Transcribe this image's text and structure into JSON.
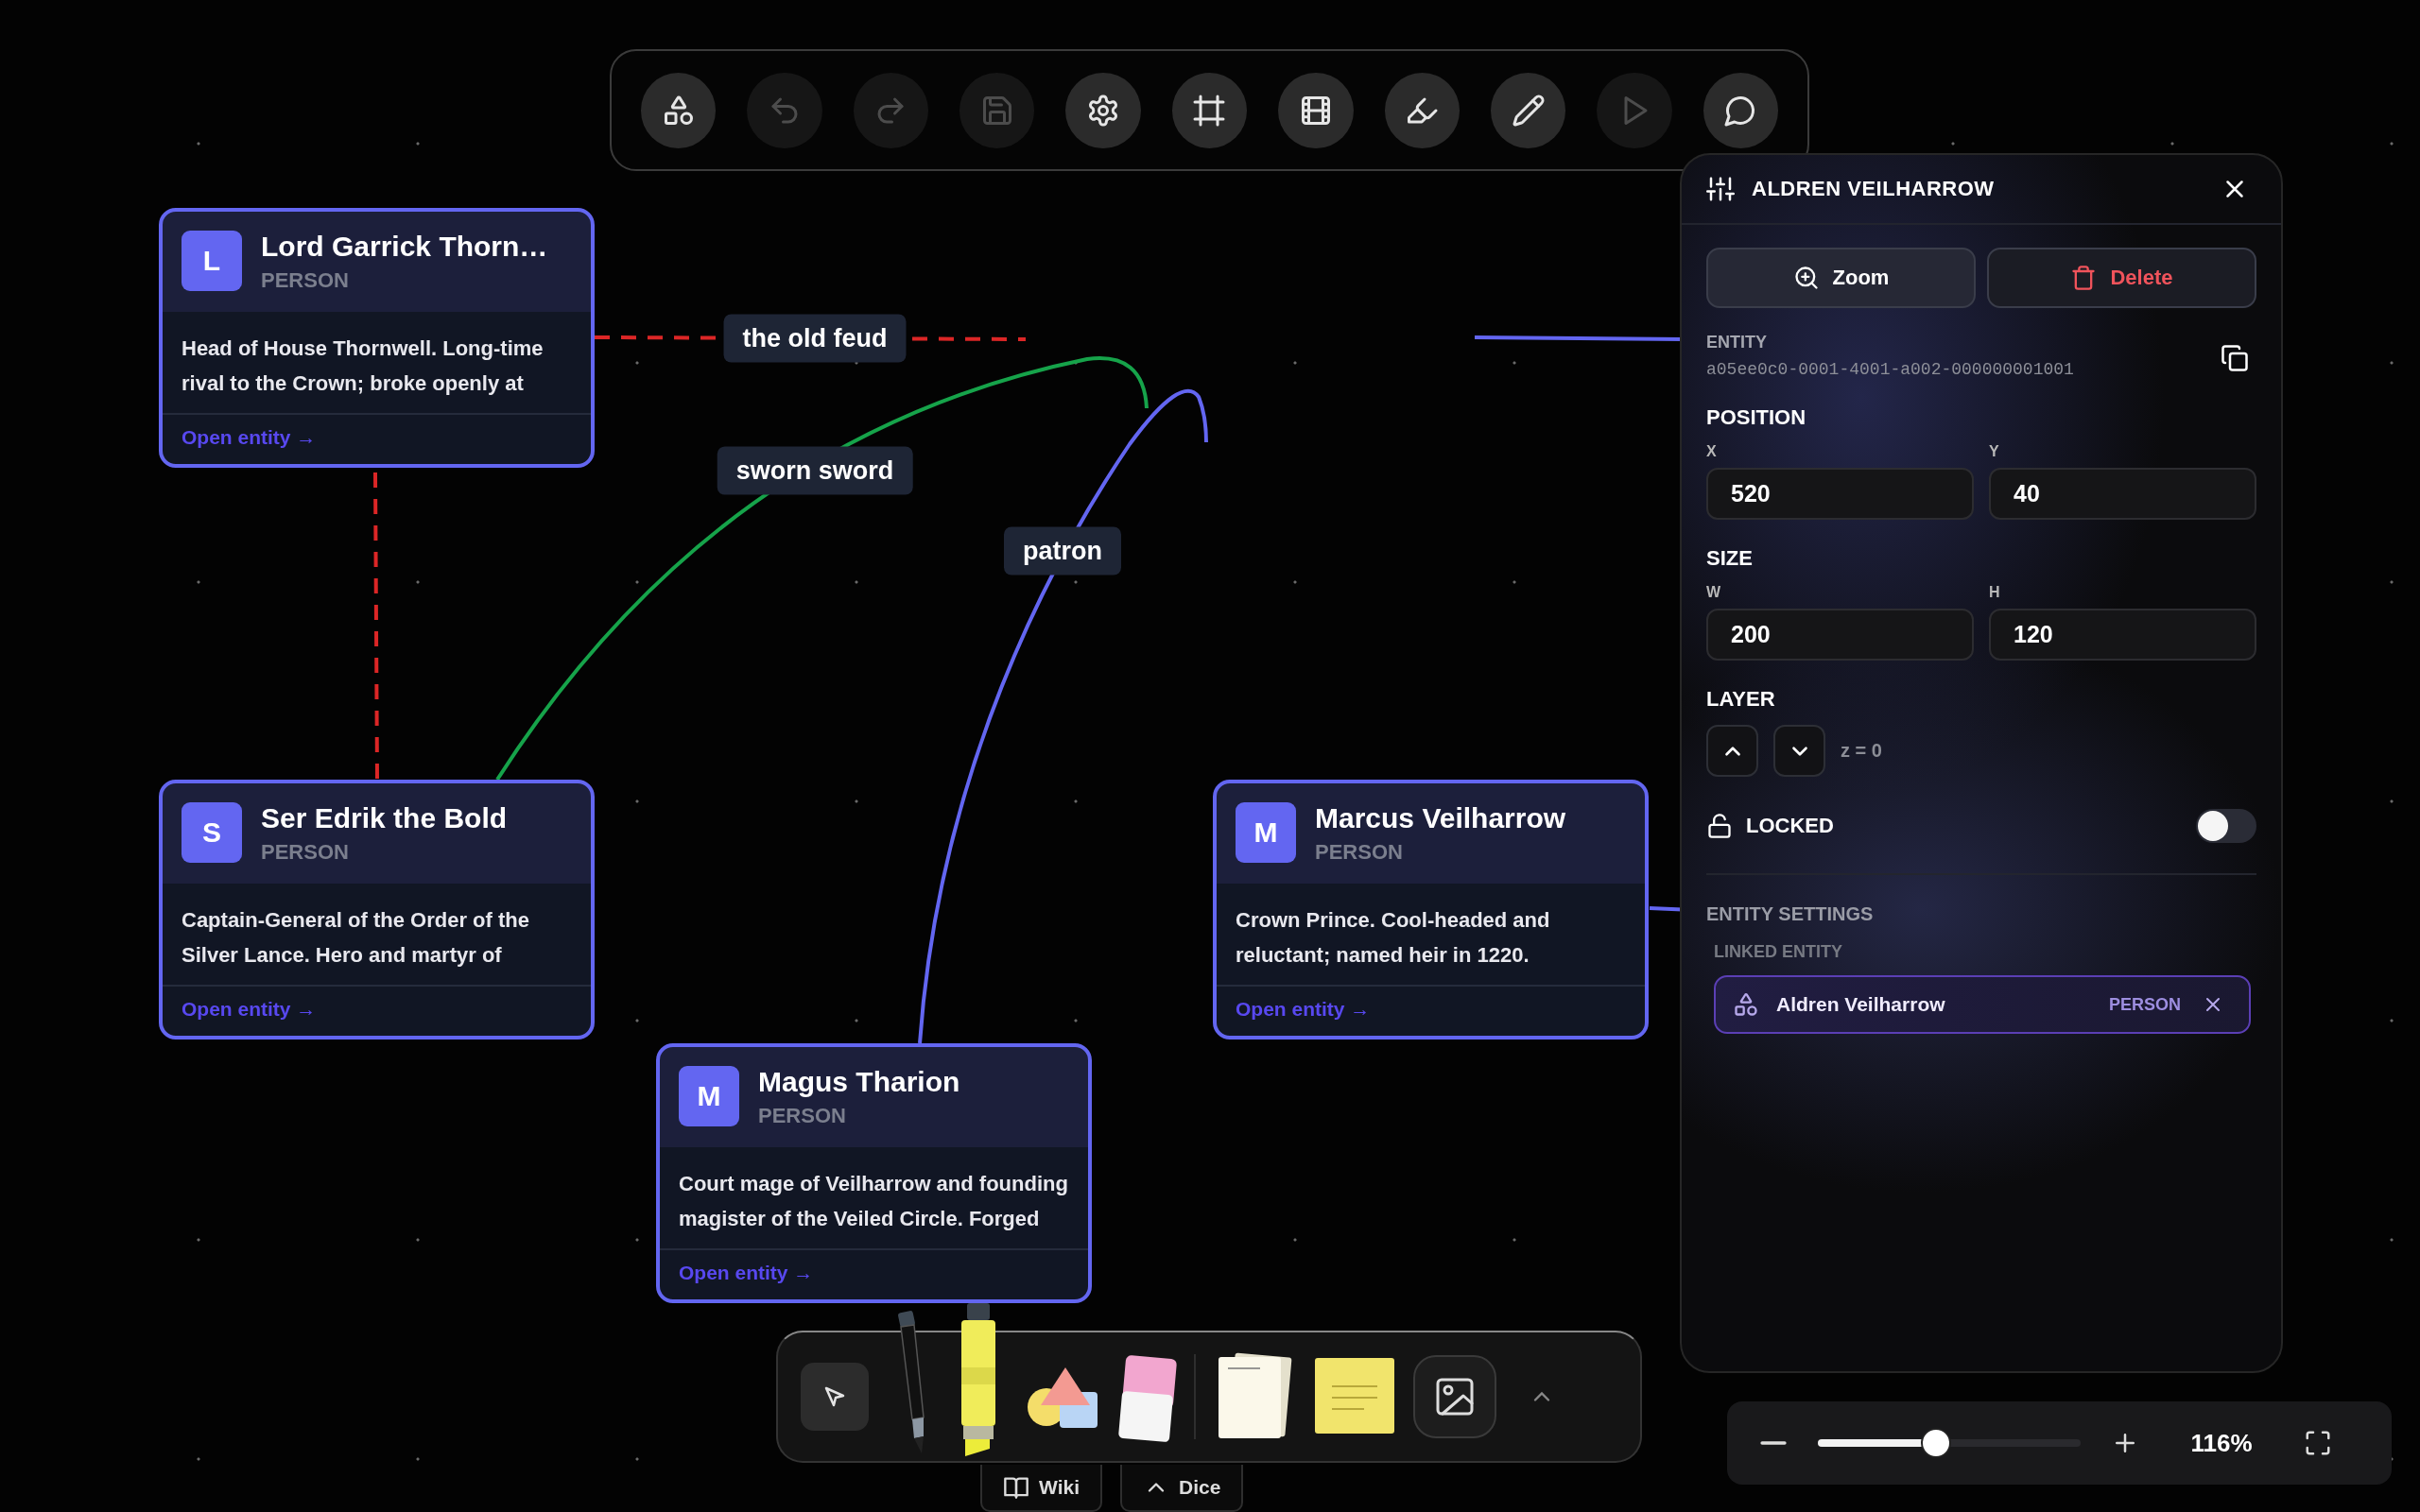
{
  "toolbar": [
    {
      "kind": "shapes",
      "disabled": false
    },
    {
      "kind": "undo",
      "disabled": true
    },
    {
      "kind": "redo",
      "disabled": true
    },
    {
      "kind": "save",
      "disabled": true
    },
    {
      "kind": "settings",
      "disabled": false
    },
    {
      "kind": "frame",
      "disabled": false
    },
    {
      "kind": "film",
      "disabled": false
    },
    {
      "kind": "highlighter",
      "disabled": false
    },
    {
      "kind": "pencil",
      "disabled": false
    },
    {
      "kind": "play",
      "disabled": true
    },
    {
      "kind": "comment",
      "disabled": false
    }
  ],
  "canvas": {
    "nodes": [
      {
        "initial": "L",
        "name": "Lord Garrick Thorn…",
        "type": "PERSON",
        "description": "Head of House Thornwell. Long-time rival to the Crown; broke openly at",
        "link": "Open entity →"
      },
      {
        "initial": "S",
        "name": "Ser Edrik the Bold",
        "type": "PERSON",
        "description": "Captain-General of the Order of the Silver Lance. Hero and martyr of",
        "link": "Open entity →"
      },
      {
        "initial": "M",
        "name": "Magus Tharion",
        "type": "PERSON",
        "description": "Court mage of Veilharrow and founding magister of the Veiled Circle. Forged",
        "link": "Open entity →"
      },
      {
        "initial": "M",
        "name": "Marcus Veilharrow",
        "type": "PERSON",
        "description": "Crown Prince. Cool-headed and reluctant; named heir in 1220.",
        "link": "Open entity →"
      }
    ],
    "edges": [
      {
        "label": "the old feud",
        "color": "#dc2626",
        "dashed": true
      },
      {
        "color": "#dc2626",
        "dashed": true
      },
      {
        "label": "sworn sword",
        "color": "#16a34a",
        "dashed": false
      },
      {
        "label": "patron",
        "color": "#6366f1",
        "dashed": false
      },
      {
        "color": "#6366f1",
        "dashed": false
      },
      {
        "color": "#6366f1",
        "dashed": false
      }
    ]
  },
  "inspector": {
    "title": "ALDREN VEILHARROW",
    "actions": [
      {
        "label": "Zoom",
        "kind": "zoom"
      },
      {
        "label": "Delete",
        "kind": "delete"
      }
    ],
    "entity": {
      "label": "ENTITY",
      "id": "a05ee0c0-0001-4001-a002-000000001001"
    },
    "position": {
      "label": "POSITION",
      "fields": [
        {
          "label": "X",
          "value": "520"
        },
        {
          "label": "Y",
          "value": "40"
        }
      ]
    },
    "size": {
      "label": "SIZE",
      "fields": [
        {
          "label": "W",
          "value": "200"
        },
        {
          "label": "H",
          "value": "120"
        }
      ]
    },
    "layer": {
      "label": "LAYER",
      "reading": "z = 0"
    },
    "locked": {
      "label": "LOCKED",
      "on": false
    },
    "entity_settings": {
      "label": "ENTITY SETTINGS",
      "linked_label": "LINKED ENTITY",
      "linked": {
        "name": "Aldren Veilharrow",
        "type": "PERSON"
      }
    }
  },
  "drawing_tools": [
    {
      "kind": "select",
      "selected": true
    },
    {
      "kind": "pen",
      "selected": false
    },
    {
      "kind": "highlighter",
      "selected": false
    },
    {
      "kind": "shapes",
      "selected": false
    },
    {
      "kind": "eraser",
      "selected": false
    },
    {
      "kind": "paper",
      "selected": false
    },
    {
      "kind": "sticky",
      "selected": false
    },
    {
      "kind": "image",
      "selected": false
    }
  ],
  "tabs": [
    {
      "label": "Wiki",
      "kind": "book"
    },
    {
      "label": "Dice",
      "kind": "caret"
    }
  ],
  "zoom": {
    "level": 0.45,
    "reading": "116%"
  }
}
